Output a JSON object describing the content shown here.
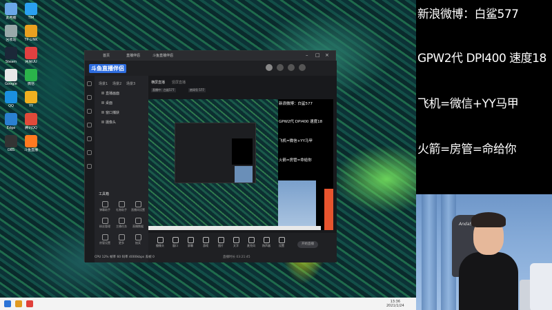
{
  "overlay": {
    "lines": [
      "新浪微博：白鲨577",
      "GPW2代 DPI400 速度18",
      "飞机=微信+YY马甲",
      "火箭=房管=命给你"
    ]
  },
  "desktop_icons": [
    {
      "label": "此电脑",
      "color": "#6aa7e8"
    },
    {
      "label": "TIM",
      "color": "#2aa0f0"
    },
    {
      "label": "回收站",
      "color": "#9aa"
    },
    {
      "label": "TP-LINK",
      "color": "#e8a020"
    },
    {
      "label": "Steam",
      "color": "#1b2838"
    },
    {
      "label": "网易UU",
      "color": "#e04040"
    },
    {
      "label": "Google",
      "color": "#e8e8e8"
    },
    {
      "label": "微信",
      "color": "#2ab34a"
    },
    {
      "label": "QQ",
      "color": "#1a90e0"
    },
    {
      "label": "YY",
      "color": "#f0b020"
    },
    {
      "label": "Edge",
      "color": "#2a80d0"
    },
    {
      "label": "腾讯QQ",
      "color": "#e04a3a"
    },
    {
      "label": "OBS",
      "color": "#333"
    },
    {
      "label": "斗鱼直播",
      "color": "#ff7a20"
    }
  ],
  "app": {
    "tabs": [
      "首页",
      "直播伴侣",
      "斗鱼直播伴侣"
    ],
    "logo": "斗鱼直播伴侣",
    "scene_tabs": [
      "场景1",
      "场景2",
      "场景3"
    ],
    "scenes": [
      "直播画面",
      "桌面",
      "窗口捕获",
      "摄像头"
    ],
    "tools_title": "工具箱",
    "tools": [
      "弹幕助手",
      "礼物助手",
      "直播间设置",
      "粉丝管理",
      "主播任务",
      "直播数据",
      "房管设置",
      "更多",
      "抽奖"
    ],
    "preview_tabs": [
      "横屏直播",
      "竖屏直播"
    ],
    "preview_chips": [
      "直播中：白鲨577",
      "房间号 577"
    ],
    "controls": [
      "摄像头",
      "窗口",
      "屏幕",
      "游戏",
      "图片",
      "文字",
      "麦克风",
      "扬声器",
      "设置"
    ],
    "go_live": "开始直播",
    "status_line": "CPU 12%  帧率 60  码率 4000kbps  丢帧 0",
    "bottom_line": "直播时长 03:21:45"
  },
  "preview_overlay": [
    "新浪微博：白鲨577",
    "GPW2代 DPI400 速度18",
    "飞机=微信+YY马甲",
    "火箭=房管=命给你"
  ],
  "taskbar": {
    "time": "13:36",
    "date": "2021/1/24"
  },
  "webcam": {
    "chair_brand": "AndaSeat"
  }
}
